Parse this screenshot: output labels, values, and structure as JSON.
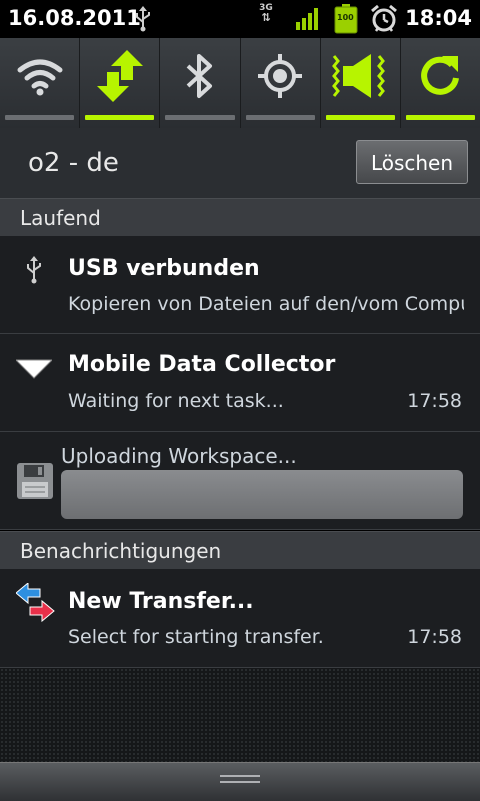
{
  "status_bar": {
    "date": "16.08.2011",
    "time": "18:04",
    "network_type": "3G",
    "battery_level": "100"
  },
  "quick_toggles": [
    {
      "name": "wifi",
      "icon": "wifi-icon",
      "active": false
    },
    {
      "name": "mobile-data",
      "icon": "data-arrows-icon",
      "active": true
    },
    {
      "name": "bluetooth",
      "icon": "bluetooth-icon",
      "active": false
    },
    {
      "name": "gps",
      "icon": "gps-icon",
      "active": false
    },
    {
      "name": "sound",
      "icon": "speaker-icon",
      "active": true
    },
    {
      "name": "auto-rotate",
      "icon": "rotate-icon",
      "active": true
    }
  ],
  "carrier": {
    "name": "o2 - de",
    "clear_label": "Löschen"
  },
  "ongoing": {
    "header": "Laufend",
    "items": [
      {
        "title": "USB verbunden",
        "text": "Kopieren von Dateien auf den/vom Computer",
        "time": ""
      },
      {
        "title": "Mobile Data Collector",
        "text": "Waiting for next task...",
        "time": "17:58"
      }
    ],
    "upload": {
      "label": "Uploading Workspace...",
      "progress": 0
    }
  },
  "notifications": {
    "header": "Benachrichtigungen",
    "items": [
      {
        "title": "New Transfer...",
        "text": "Select for starting transfer.",
        "time": "17:58"
      }
    ]
  },
  "colors": {
    "accent": "#b7f400",
    "background": "#1c1e21",
    "section_header": "#3a3d41"
  }
}
